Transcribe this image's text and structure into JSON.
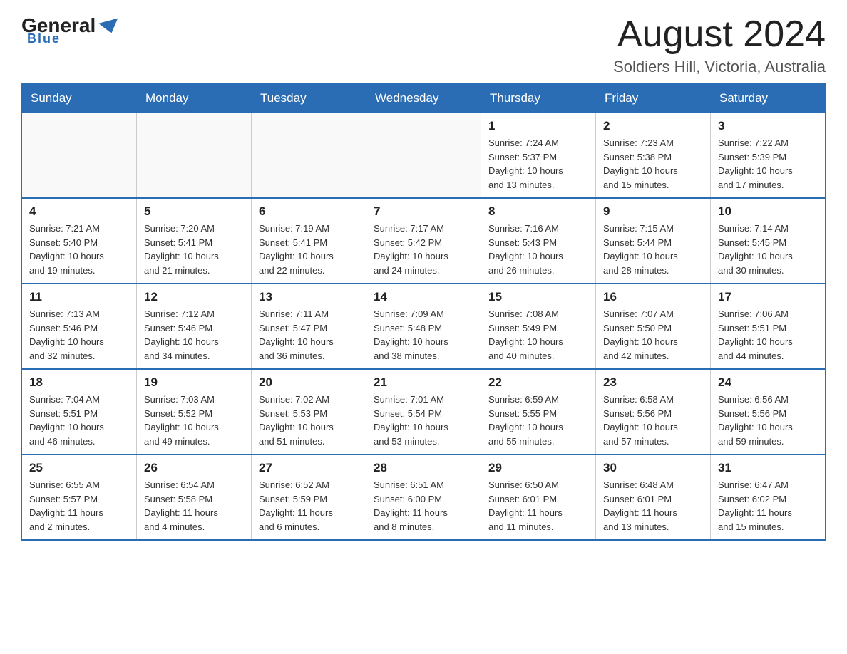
{
  "header": {
    "title": "August 2024",
    "subtitle": "Soldiers Hill, Victoria, Australia"
  },
  "logo": {
    "general": "General",
    "blue": "Blue"
  },
  "days_of_week": [
    "Sunday",
    "Monday",
    "Tuesday",
    "Wednesday",
    "Thursday",
    "Friday",
    "Saturday"
  ],
  "weeks": [
    [
      {
        "day": "",
        "info": ""
      },
      {
        "day": "",
        "info": ""
      },
      {
        "day": "",
        "info": ""
      },
      {
        "day": "",
        "info": ""
      },
      {
        "day": "1",
        "info": "Sunrise: 7:24 AM\nSunset: 5:37 PM\nDaylight: 10 hours\nand 13 minutes."
      },
      {
        "day": "2",
        "info": "Sunrise: 7:23 AM\nSunset: 5:38 PM\nDaylight: 10 hours\nand 15 minutes."
      },
      {
        "day": "3",
        "info": "Sunrise: 7:22 AM\nSunset: 5:39 PM\nDaylight: 10 hours\nand 17 minutes."
      }
    ],
    [
      {
        "day": "4",
        "info": "Sunrise: 7:21 AM\nSunset: 5:40 PM\nDaylight: 10 hours\nand 19 minutes."
      },
      {
        "day": "5",
        "info": "Sunrise: 7:20 AM\nSunset: 5:41 PM\nDaylight: 10 hours\nand 21 minutes."
      },
      {
        "day": "6",
        "info": "Sunrise: 7:19 AM\nSunset: 5:41 PM\nDaylight: 10 hours\nand 22 minutes."
      },
      {
        "day": "7",
        "info": "Sunrise: 7:17 AM\nSunset: 5:42 PM\nDaylight: 10 hours\nand 24 minutes."
      },
      {
        "day": "8",
        "info": "Sunrise: 7:16 AM\nSunset: 5:43 PM\nDaylight: 10 hours\nand 26 minutes."
      },
      {
        "day": "9",
        "info": "Sunrise: 7:15 AM\nSunset: 5:44 PM\nDaylight: 10 hours\nand 28 minutes."
      },
      {
        "day": "10",
        "info": "Sunrise: 7:14 AM\nSunset: 5:45 PM\nDaylight: 10 hours\nand 30 minutes."
      }
    ],
    [
      {
        "day": "11",
        "info": "Sunrise: 7:13 AM\nSunset: 5:46 PM\nDaylight: 10 hours\nand 32 minutes."
      },
      {
        "day": "12",
        "info": "Sunrise: 7:12 AM\nSunset: 5:46 PM\nDaylight: 10 hours\nand 34 minutes."
      },
      {
        "day": "13",
        "info": "Sunrise: 7:11 AM\nSunset: 5:47 PM\nDaylight: 10 hours\nand 36 minutes."
      },
      {
        "day": "14",
        "info": "Sunrise: 7:09 AM\nSunset: 5:48 PM\nDaylight: 10 hours\nand 38 minutes."
      },
      {
        "day": "15",
        "info": "Sunrise: 7:08 AM\nSunset: 5:49 PM\nDaylight: 10 hours\nand 40 minutes."
      },
      {
        "day": "16",
        "info": "Sunrise: 7:07 AM\nSunset: 5:50 PM\nDaylight: 10 hours\nand 42 minutes."
      },
      {
        "day": "17",
        "info": "Sunrise: 7:06 AM\nSunset: 5:51 PM\nDaylight: 10 hours\nand 44 minutes."
      }
    ],
    [
      {
        "day": "18",
        "info": "Sunrise: 7:04 AM\nSunset: 5:51 PM\nDaylight: 10 hours\nand 46 minutes."
      },
      {
        "day": "19",
        "info": "Sunrise: 7:03 AM\nSunset: 5:52 PM\nDaylight: 10 hours\nand 49 minutes."
      },
      {
        "day": "20",
        "info": "Sunrise: 7:02 AM\nSunset: 5:53 PM\nDaylight: 10 hours\nand 51 minutes."
      },
      {
        "day": "21",
        "info": "Sunrise: 7:01 AM\nSunset: 5:54 PM\nDaylight: 10 hours\nand 53 minutes."
      },
      {
        "day": "22",
        "info": "Sunrise: 6:59 AM\nSunset: 5:55 PM\nDaylight: 10 hours\nand 55 minutes."
      },
      {
        "day": "23",
        "info": "Sunrise: 6:58 AM\nSunset: 5:56 PM\nDaylight: 10 hours\nand 57 minutes."
      },
      {
        "day": "24",
        "info": "Sunrise: 6:56 AM\nSunset: 5:56 PM\nDaylight: 10 hours\nand 59 minutes."
      }
    ],
    [
      {
        "day": "25",
        "info": "Sunrise: 6:55 AM\nSunset: 5:57 PM\nDaylight: 11 hours\nand 2 minutes."
      },
      {
        "day": "26",
        "info": "Sunrise: 6:54 AM\nSunset: 5:58 PM\nDaylight: 11 hours\nand 4 minutes."
      },
      {
        "day": "27",
        "info": "Sunrise: 6:52 AM\nSunset: 5:59 PM\nDaylight: 11 hours\nand 6 minutes."
      },
      {
        "day": "28",
        "info": "Sunrise: 6:51 AM\nSunset: 6:00 PM\nDaylight: 11 hours\nand 8 minutes."
      },
      {
        "day": "29",
        "info": "Sunrise: 6:50 AM\nSunset: 6:01 PM\nDaylight: 11 hours\nand 11 minutes."
      },
      {
        "day": "30",
        "info": "Sunrise: 6:48 AM\nSunset: 6:01 PM\nDaylight: 11 hours\nand 13 minutes."
      },
      {
        "day": "31",
        "info": "Sunrise: 6:47 AM\nSunset: 6:02 PM\nDaylight: 11 hours\nand 15 minutes."
      }
    ]
  ]
}
